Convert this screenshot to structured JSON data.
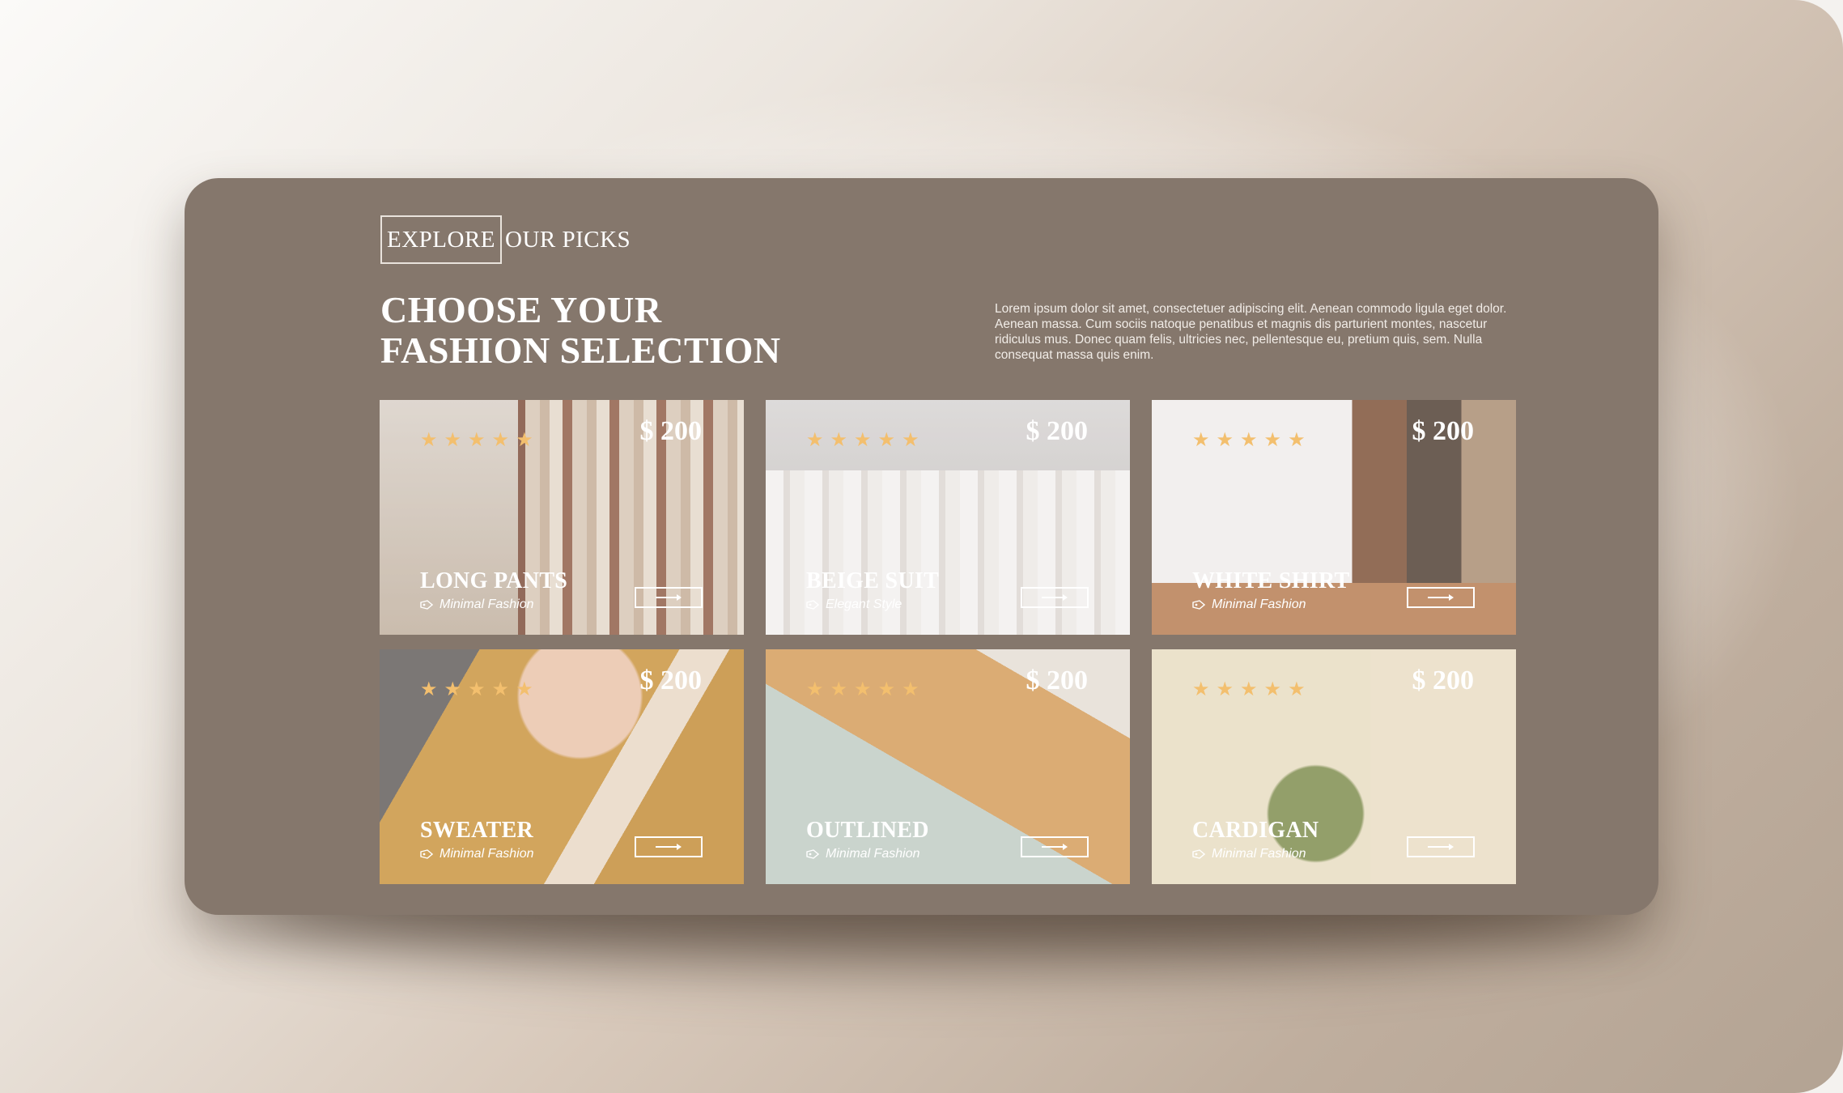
{
  "header": {
    "eyebrow_boxed": "EXPLORE",
    "eyebrow_rest": "OUR PICKS",
    "headline_line1": "CHOOSE YOUR",
    "headline_line2": "FASHION SELECTION",
    "description": "Lorem ipsum dolor sit amet, consectetuer adipiscing elit. Aenean commodo ligula eget dolor. Aenean massa. Cum sociis natoque penatibus et magnis dis parturient montes, nascetur ridiculus mus. Donec quam felis, ultricies nec, pellentesque eu, pretium quis, sem. Nulla consequat massa quis enim."
  },
  "colors": {
    "panel": "#85776c",
    "star": "#f3bf6e",
    "text": "#ffffff"
  },
  "products": [
    {
      "name": "LONG PANTS",
      "category": "Minimal Fashion",
      "price": "$ 200",
      "rating": 5
    },
    {
      "name": "BEIGE SUIT",
      "category": "Elegant Style",
      "price": "$ 200",
      "rating": 5
    },
    {
      "name": "WHITE SHIRT",
      "category": "Minimal Fashion",
      "price": "$ 200",
      "rating": 5
    },
    {
      "name": "SWEATER",
      "category": "Minimal Fashion",
      "price": "$ 200",
      "rating": 5
    },
    {
      "name": "OUTLINED",
      "category": "Minimal Fashion",
      "price": "$ 200",
      "rating": 5
    },
    {
      "name": "CARDIGAN",
      "category": "Minimal Fashion",
      "price": "$ 200",
      "rating": 5
    }
  ],
  "icons": {
    "star": "star-icon",
    "tag": "tag-icon",
    "arrow": "arrow-right-icon"
  }
}
